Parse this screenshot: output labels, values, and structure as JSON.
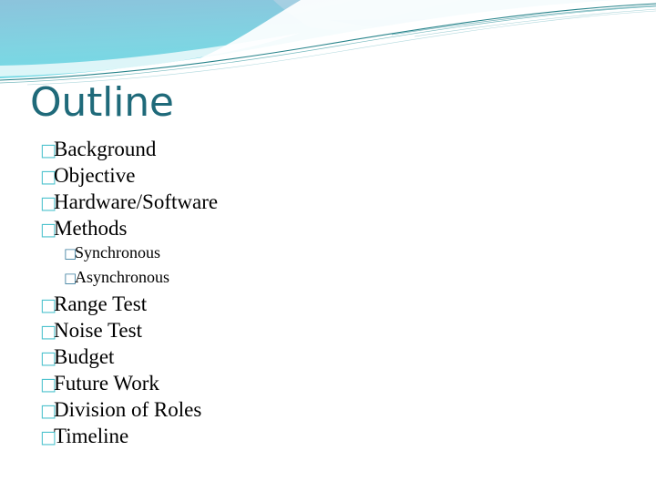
{
  "slide": {
    "title": "Outline",
    "title_color": "#1F6A7A",
    "background_color": "#FFFFFF"
  },
  "banner": {
    "name": "decorative-header-swoosh",
    "gradient_top_left": "#8CC3DC",
    "gradient_cyan": "#7EDBE5",
    "gradient_right": "#8FD4E4",
    "accent_line_color": "#1B7C84",
    "swoosh_white": "#FFFFFF"
  },
  "bullets": {
    "level1_marker": "□",
    "level2_marker": "□",
    "level1_marker_color": "#4EC3CE",
    "level2_marker_color": "#3A7C9E",
    "text_color": "#000000",
    "items": [
      {
        "label": "Background",
        "level": 1
      },
      {
        "label": "Objective",
        "level": 1
      },
      {
        "label": "Hardware/Software",
        "level": 1
      },
      {
        "label": "Methods",
        "level": 1
      },
      {
        "label": "Synchronous",
        "level": 2
      },
      {
        "label": "Asynchronous",
        "level": 2
      },
      {
        "label": "Range Test",
        "level": 1
      },
      {
        "label": "Noise Test",
        "level": 1
      },
      {
        "label": "Budget",
        "level": 1
      },
      {
        "label": "Future Work",
        "level": 1
      },
      {
        "label": "Division of Roles",
        "level": 1
      },
      {
        "label": "Timeline",
        "level": 1
      }
    ]
  }
}
